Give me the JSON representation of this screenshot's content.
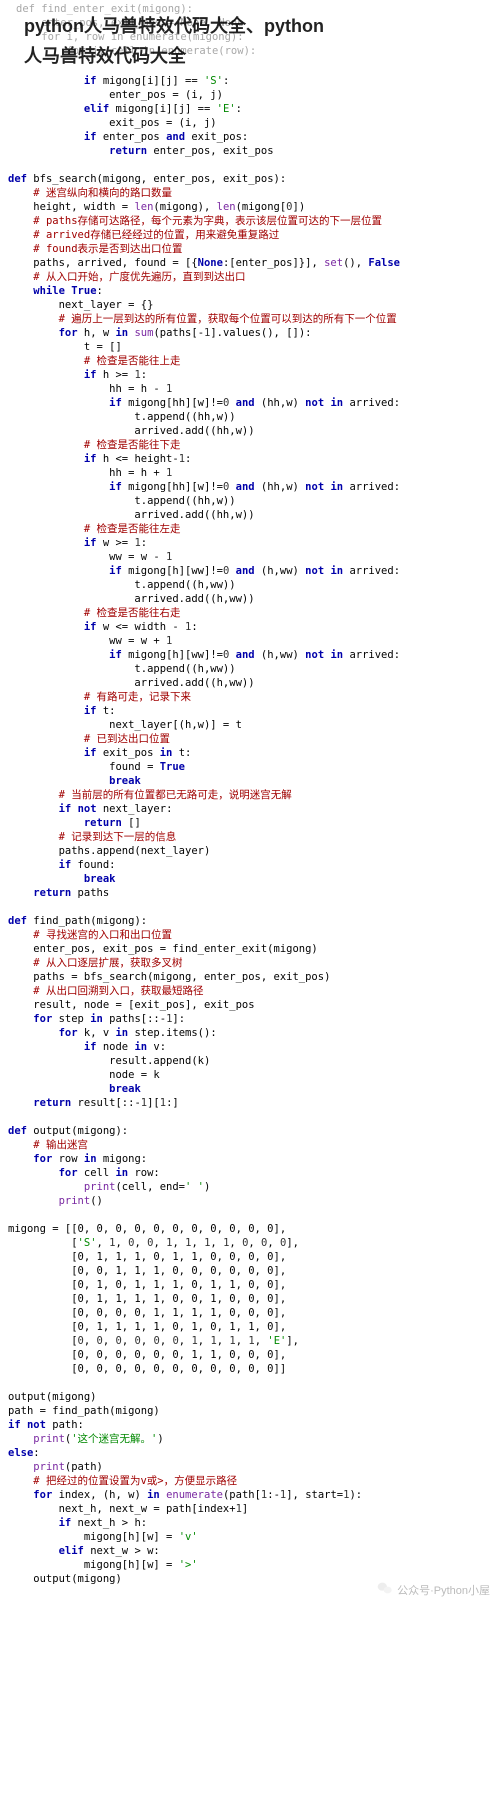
{
  "title": "python人马兽特效代码大全、python",
  "subtitle": "人马兽特效代码大全",
  "ghost_lines": [
    "def find_enter_exit(migong):",
    "    enter_pos, exit_pos = None, None",
    "    for i, row in enumerate(migong):",
    "        for j, cell in enumerate(row):"
  ],
  "footer_label": "公众号·Python小屋",
  "code": {
    "fn_find_enter_exit": {
      "l1": "if migong[i][j] == 'S':",
      "l2": "enter_pos = (i, j)",
      "l3": "elif migong[i][j] == 'E':",
      "l4": "exit_pos = (i, j)",
      "l5": "if enter_pos and exit_pos:",
      "l6": "return enter_pos, exit_pos"
    },
    "fn_bfs": {
      "sig": "def bfs_search(migong, enter_pos, exit_pos):",
      "c1": "# 迷宫纵向和横向的路口数量",
      "l1": "height, width = len(migong), len(migong[0])",
      "c2": "# paths存储可达路径，每个元素为字典，表示该层位置可达的下一层位置",
      "c3": "# arrived存储已经经过的位置，用来避免重复路过",
      "c4": "# found表示是否到达出口位置",
      "l2": "paths, arrived, found = [{None:[enter_pos]}], set(), False",
      "c5": "# 从入口开始，广度优先遍历，直到到达出口",
      "l3": "while True:",
      "l4": "next_layer = {}",
      "c6": "# 遍历上一层到达的所有位置，获取每个位置可以到达的所有下一个位置",
      "l5": "for h, w in sum(paths[-1].values(), []):",
      "l6": "t = []",
      "c7": "# 检查是否能往上走",
      "l7": "if h >= 1:",
      "l8": "hh = h - 1",
      "l9": "if migong[hh][w]!=0 and (hh,w) not in arrived:",
      "l10": "t.append((hh,w))",
      "l11": "arrived.add((hh,w))",
      "c8": "# 检查是否能往下走",
      "l12": "if h <= height-1:",
      "l13": "hh = h + 1",
      "l14": "if migong[hh][w]!=0 and (hh,w) not in arrived:",
      "l15": "t.append((hh,w))",
      "l16": "arrived.add((hh,w))",
      "c9": "# 检查是否能往左走",
      "l17": "if w >= 1:",
      "l18": "ww = w - 1",
      "l19": "if migong[h][ww]!=0 and (h,ww) not in arrived:",
      "l20": "t.append((h,ww))",
      "l21": "arrived.add((h,ww))",
      "c10": "# 检查是否能往右走",
      "l22": "if w <= width - 1:",
      "l23": "ww = w + 1",
      "l24": "if migong[h][ww]!=0 and (h,ww) not in arrived:",
      "l25": "t.append((h,ww))",
      "l26": "arrived.add((h,ww))",
      "c11": "# 有路可走，记录下来",
      "l27": "if t:",
      "l28": "next_layer[(h,w)] = t",
      "c12": "# 已到达出口位置",
      "l29": "if exit_pos in t:",
      "l30": "found = True",
      "l31": "break",
      "c13": "# 当前层的所有位置都已无路可走，说明迷宫无解",
      "l32": "if not next_layer:",
      "l33": "return []",
      "c14": "# 记录到达下一层的信息",
      "l34": "paths.append(next_layer)",
      "l35": "if found:",
      "l36": "break",
      "l37": "return paths"
    },
    "fn_find_path": {
      "sig": "def find_path(migong):",
      "c1": "# 寻找迷宫的入口和出口位置",
      "l1": "enter_pos, exit_pos = find_enter_exit(migong)",
      "c2": "# 从入口逐层扩展，获取多叉树",
      "l2": "paths = bfs_search(migong, enter_pos, exit_pos)",
      "c3": "# 从出口回溯到入口，获取最短路径",
      "l3": "result, node = [exit_pos], exit_pos",
      "l4": "for step in paths[::-1]:",
      "l5": "for k, v in step.items():",
      "l6": "if node in v:",
      "l7": "result.append(k)",
      "l8": "node = k",
      "l9": "break",
      "l10": "return result[::-1][1:]"
    },
    "fn_output": {
      "sig": "def output(migong):",
      "c1": "# 输出迷宫",
      "l1": "for row in migong:",
      "l2": "for cell in row:",
      "l3": "print(cell, end=' ')",
      "l4": "print()"
    },
    "migong": {
      "r0": "migong = [[0, 0, 0, 0, 0, 0, 0, 0, 0, 0, 0],",
      "r1": "['S', 1, 0, 0, 1, 1, 1, 1, 0, 0, 0],",
      "r2": "[0, 1, 1, 1, 0, 1, 1, 0, 0, 0, 0],",
      "r3": "[0, 0, 1, 1, 1, 0, 0, 0, 0, 0, 0],",
      "r4": "[0, 1, 0, 1, 1, 1, 0, 1, 1, 0, 0],",
      "r5": "[0, 1, 1, 1, 1, 0, 0, 1, 0, 0, 0],",
      "r6": "[0, 0, 0, 0, 1, 1, 1, 1, 0, 0, 0],",
      "r7": "[0, 1, 1, 1, 1, 0, 1, 0, 1, 1, 0],",
      "r8": "[0, 0, 0, 0, 0, 0, 1, 1, 1, 1, 'E'],",
      "r9": "[0, 0, 0, 0, 0, 0, 1, 1, 0, 0, 0],",
      "r10": "[0, 0, 0, 0, 0, 0, 0, 0, 0, 0, 0]]"
    },
    "main": {
      "l1": "output(migong)",
      "l2": "path = find_path(migong)",
      "l3": "if not path:",
      "l4": "print('这个迷宫无解。')",
      "l5": "else:",
      "l6": "print(path)",
      "c1": "# 把经过的位置设置为v或>，方便显示路径",
      "l7": "for index, (h, w) in enumerate(path[1:-1], start=1):",
      "l8": "next_h, next_w = path[index+1]",
      "l9": "if next_h > h:",
      "l10": "migong[h][w] = 'v'",
      "l11": "elif next_w > w:",
      "l12": "migong[h][w] = '>'",
      "l13": "output(migong)"
    }
  }
}
